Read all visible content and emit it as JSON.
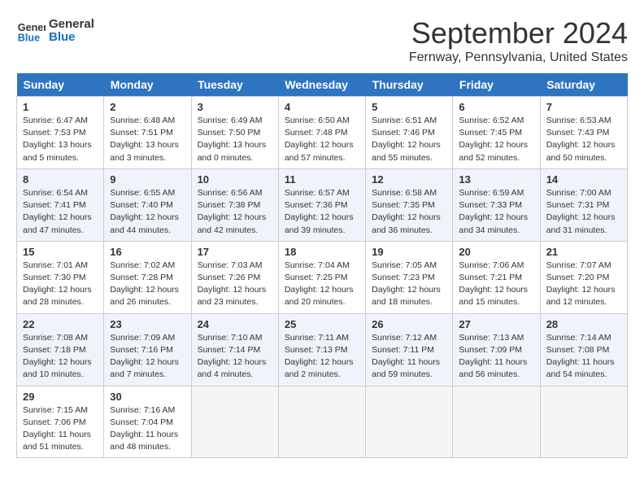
{
  "header": {
    "logo_line1": "General",
    "logo_line2": "Blue",
    "month": "September 2024",
    "location": "Fernway, Pennsylvania, United States"
  },
  "weekdays": [
    "Sunday",
    "Monday",
    "Tuesday",
    "Wednesday",
    "Thursday",
    "Friday",
    "Saturday"
  ],
  "weeks": [
    [
      {
        "day": 1,
        "info": "Sunrise: 6:47 AM\nSunset: 7:53 PM\nDaylight: 13 hours\nand 5 minutes."
      },
      {
        "day": 2,
        "info": "Sunrise: 6:48 AM\nSunset: 7:51 PM\nDaylight: 13 hours\nand 3 minutes."
      },
      {
        "day": 3,
        "info": "Sunrise: 6:49 AM\nSunset: 7:50 PM\nDaylight: 13 hours\nand 0 minutes."
      },
      {
        "day": 4,
        "info": "Sunrise: 6:50 AM\nSunset: 7:48 PM\nDaylight: 12 hours\nand 57 minutes."
      },
      {
        "day": 5,
        "info": "Sunrise: 6:51 AM\nSunset: 7:46 PM\nDaylight: 12 hours\nand 55 minutes."
      },
      {
        "day": 6,
        "info": "Sunrise: 6:52 AM\nSunset: 7:45 PM\nDaylight: 12 hours\nand 52 minutes."
      },
      {
        "day": 7,
        "info": "Sunrise: 6:53 AM\nSunset: 7:43 PM\nDaylight: 12 hours\nand 50 minutes."
      }
    ],
    [
      {
        "day": 8,
        "info": "Sunrise: 6:54 AM\nSunset: 7:41 PM\nDaylight: 12 hours\nand 47 minutes."
      },
      {
        "day": 9,
        "info": "Sunrise: 6:55 AM\nSunset: 7:40 PM\nDaylight: 12 hours\nand 44 minutes."
      },
      {
        "day": 10,
        "info": "Sunrise: 6:56 AM\nSunset: 7:38 PM\nDaylight: 12 hours\nand 42 minutes."
      },
      {
        "day": 11,
        "info": "Sunrise: 6:57 AM\nSunset: 7:36 PM\nDaylight: 12 hours\nand 39 minutes."
      },
      {
        "day": 12,
        "info": "Sunrise: 6:58 AM\nSunset: 7:35 PM\nDaylight: 12 hours\nand 36 minutes."
      },
      {
        "day": 13,
        "info": "Sunrise: 6:59 AM\nSunset: 7:33 PM\nDaylight: 12 hours\nand 34 minutes."
      },
      {
        "day": 14,
        "info": "Sunrise: 7:00 AM\nSunset: 7:31 PM\nDaylight: 12 hours\nand 31 minutes."
      }
    ],
    [
      {
        "day": 15,
        "info": "Sunrise: 7:01 AM\nSunset: 7:30 PM\nDaylight: 12 hours\nand 28 minutes."
      },
      {
        "day": 16,
        "info": "Sunrise: 7:02 AM\nSunset: 7:28 PM\nDaylight: 12 hours\nand 26 minutes."
      },
      {
        "day": 17,
        "info": "Sunrise: 7:03 AM\nSunset: 7:26 PM\nDaylight: 12 hours\nand 23 minutes."
      },
      {
        "day": 18,
        "info": "Sunrise: 7:04 AM\nSunset: 7:25 PM\nDaylight: 12 hours\nand 20 minutes."
      },
      {
        "day": 19,
        "info": "Sunrise: 7:05 AM\nSunset: 7:23 PM\nDaylight: 12 hours\nand 18 minutes."
      },
      {
        "day": 20,
        "info": "Sunrise: 7:06 AM\nSunset: 7:21 PM\nDaylight: 12 hours\nand 15 minutes."
      },
      {
        "day": 21,
        "info": "Sunrise: 7:07 AM\nSunset: 7:20 PM\nDaylight: 12 hours\nand 12 minutes."
      }
    ],
    [
      {
        "day": 22,
        "info": "Sunrise: 7:08 AM\nSunset: 7:18 PM\nDaylight: 12 hours\nand 10 minutes."
      },
      {
        "day": 23,
        "info": "Sunrise: 7:09 AM\nSunset: 7:16 PM\nDaylight: 12 hours\nand 7 minutes."
      },
      {
        "day": 24,
        "info": "Sunrise: 7:10 AM\nSunset: 7:14 PM\nDaylight: 12 hours\nand 4 minutes."
      },
      {
        "day": 25,
        "info": "Sunrise: 7:11 AM\nSunset: 7:13 PM\nDaylight: 12 hours\nand 2 minutes."
      },
      {
        "day": 26,
        "info": "Sunrise: 7:12 AM\nSunset: 7:11 PM\nDaylight: 11 hours\nand 59 minutes."
      },
      {
        "day": 27,
        "info": "Sunrise: 7:13 AM\nSunset: 7:09 PM\nDaylight: 11 hours\nand 56 minutes."
      },
      {
        "day": 28,
        "info": "Sunrise: 7:14 AM\nSunset: 7:08 PM\nDaylight: 11 hours\nand 54 minutes."
      }
    ],
    [
      {
        "day": 29,
        "info": "Sunrise: 7:15 AM\nSunset: 7:06 PM\nDaylight: 11 hours\nand 51 minutes."
      },
      {
        "day": 30,
        "info": "Sunrise: 7:16 AM\nSunset: 7:04 PM\nDaylight: 11 hours\nand 48 minutes."
      },
      null,
      null,
      null,
      null,
      null
    ]
  ]
}
